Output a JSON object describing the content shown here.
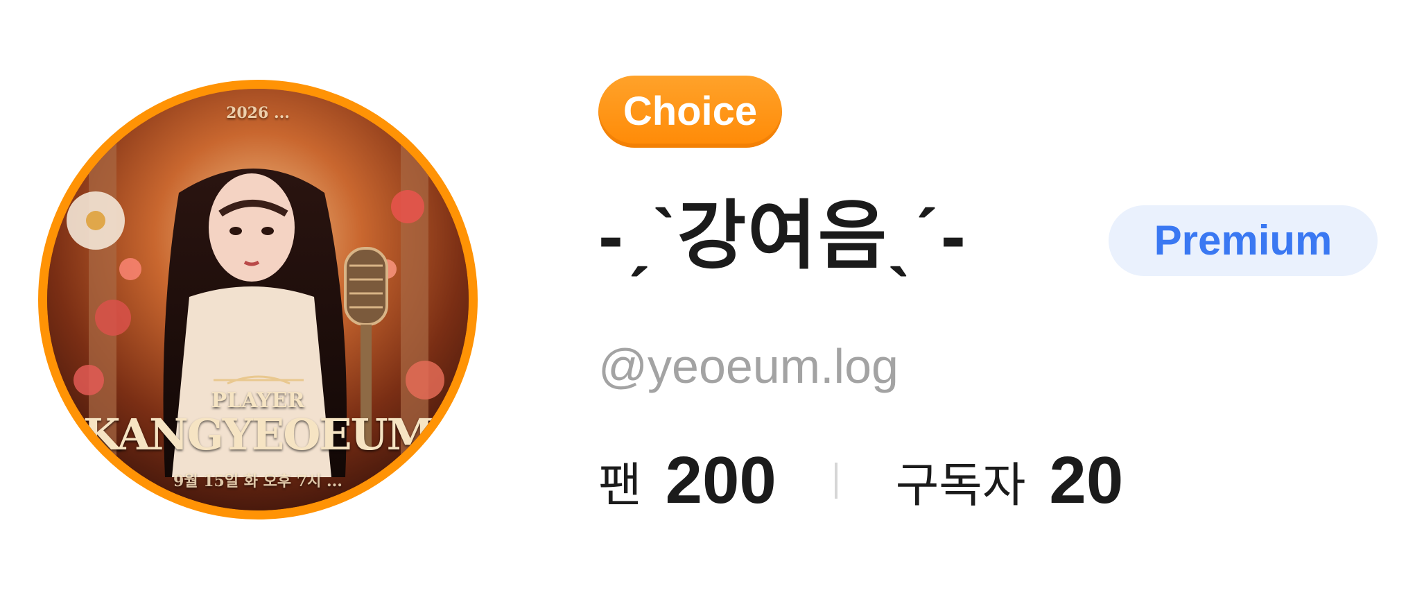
{
  "profile": {
    "avatar": {
      "image_text_top": "2026 ...",
      "image_text_player": "PLAYER",
      "image_text_name": "KANGYEOEUM",
      "image_text_bottom": "9월 15일 화 오후 7시 ...",
      "border_color": "#ff9305"
    },
    "choice_badge": "Choice",
    "nickname": "-ˏˋ강여음ˎˊ-",
    "premium_badge": "Premium",
    "handle": "@yeoeum.log",
    "stats": {
      "fans_label": "팬",
      "fans_value": "200",
      "subscribers_label": "구독자",
      "subscribers_value": "20"
    }
  },
  "colors": {
    "choice_badge": "#ff8a06",
    "premium_bg": "#eaf1fd",
    "premium_text": "#3a78f2",
    "handle_text": "#a3a3a3",
    "primary_text": "#1b1b1b"
  }
}
